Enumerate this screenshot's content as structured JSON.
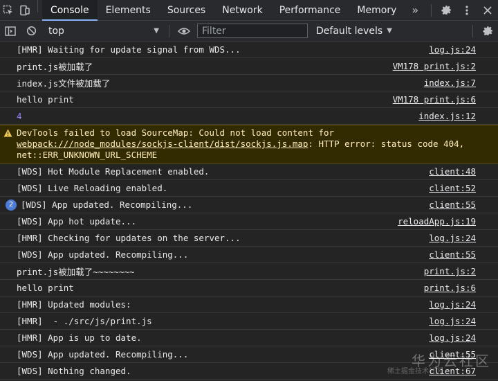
{
  "tabs": [
    {
      "label": "Console",
      "active": true
    },
    {
      "label": "Elements"
    },
    {
      "label": "Sources"
    },
    {
      "label": "Network"
    },
    {
      "label": "Performance"
    },
    {
      "label": "Memory"
    }
  ],
  "tabs_more": "»",
  "toolbar": {
    "context": "top",
    "filter_placeholder": "Filter",
    "levels": "Default levels"
  },
  "console": [
    {
      "msg": "[HMR] Waiting for update signal from WDS...",
      "src": "log.js:24"
    },
    {
      "msg": "print.js被加载了",
      "src": "VM178 print.js:2"
    },
    {
      "msg": "index.js文件被加载了",
      "src": "index.js:7"
    },
    {
      "msg": "hello print",
      "src": "VM178 print.js:6"
    },
    {
      "msg": "4",
      "src": "index.js:12",
      "number": true
    },
    {
      "type": "warning",
      "prefix": "DevTools failed to load SourceMap: Could not load content for ",
      "link": "webpack:///node_modules/sockjs-client/dist/sockjs.js.map",
      "suffix": ": HTTP error: status code 404, net::ERR_UNKNOWN_URL_SCHEME"
    },
    {
      "msg": "[WDS] Hot Module Replacement enabled.",
      "src": "client:48"
    },
    {
      "msg": "[WDS] Live Reloading enabled.",
      "src": "client:52"
    },
    {
      "msg": "[WDS] App updated. Recompiling...",
      "src": "client:55",
      "count": "2"
    },
    {
      "msg": "[WDS] App hot update...",
      "src": "reloadApp.js:19"
    },
    {
      "msg": "[HMR] Checking for updates on the server...",
      "src": "log.js:24"
    },
    {
      "msg": "[WDS] App updated. Recompiling...",
      "src": "client:55"
    },
    {
      "msg": "print.js被加载了~~~~~~~~",
      "src": "print.js:2"
    },
    {
      "msg": "hello print",
      "src": "print.js:6"
    },
    {
      "msg": "[HMR] Updated modules:",
      "src": "log.js:24"
    },
    {
      "msg": "[HMR]  - ./src/js/print.js",
      "src": "log.js:24"
    },
    {
      "msg": "[HMR] App is up to date.",
      "src": "log.js:24"
    },
    {
      "msg": "[WDS] App updated. Recompiling...",
      "src": "client:55"
    },
    {
      "msg": "[WDS] Nothing changed.",
      "src": "client:67"
    }
  ],
  "prompt": ">",
  "watermark": "华为云社区",
  "watermark_sub": "稀土掘金技术社区"
}
